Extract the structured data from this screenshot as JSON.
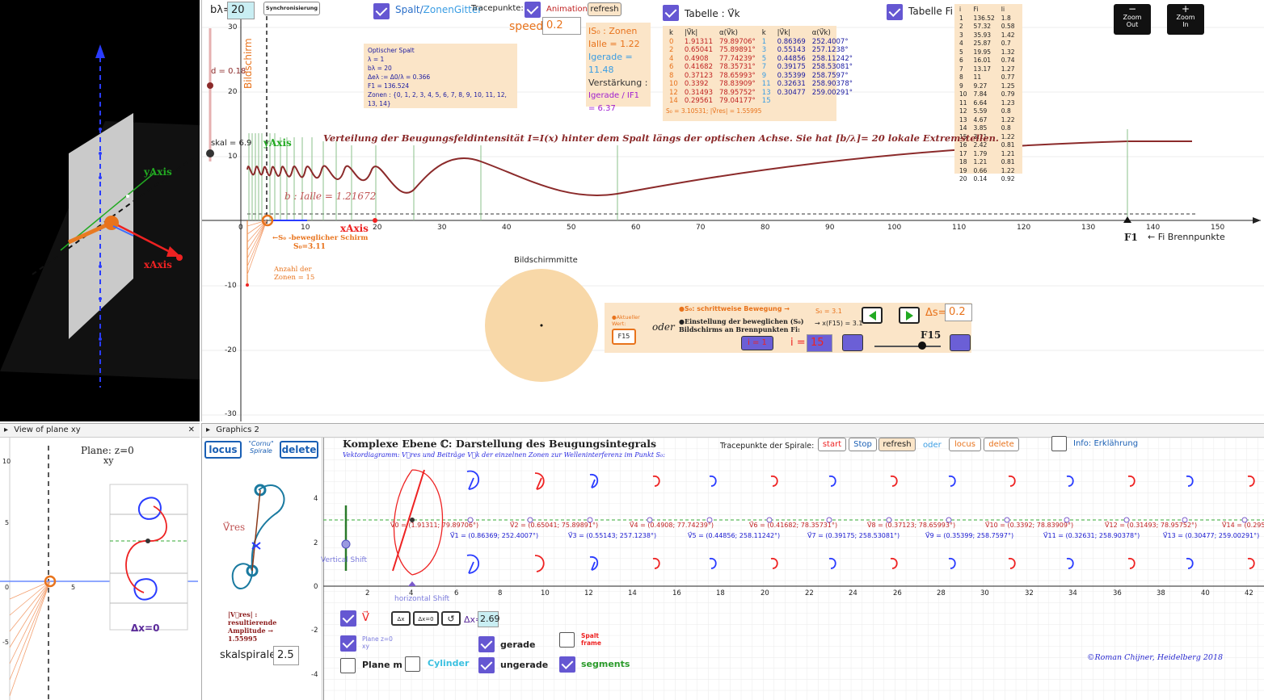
{
  "view3d": {
    "x_label": "xAxis",
    "y_label": "yAxis",
    "slider_d": "d = 0.18",
    "slider_skal": "skal = 6.9"
  },
  "top": {
    "b_lambda_label": "bλ=",
    "b_lambda_value": "20",
    "sync_button": "Synchronisierung",
    "spalt_label_a": "Spalt/",
    "spalt_label_b": "ZonenGitter",
    "tracepunkte": "Tracepunkte:",
    "animation": "Animation",
    "refresh": "refresh",
    "speed_label": "speed=",
    "speed_value": "0.2",
    "tabelle_vk": "Tabelle : V⃗k",
    "tabelle_fi": "Tabelle Fi",
    "zoom_out": "Zoom Out",
    "zoom_in": "Zoom In",
    "minus": "−",
    "plus": "+",
    "bildschirm": "Bildschirm",
    "y_axis_label": "yAxis",
    "x_axis_label": "xAxis",
    "f1_label": "F1",
    "brennpunkte": "← Fi Brennpunkte",
    "curve_title": "Verteilung der Beugungsfeldintensität I=I(x) hinter dem Spalt längs der optischen Achse. Sie hat [b/λ]= 20 lokale Extremstellen.",
    "b_label": "b : Ialle = 1.21672",
    "screen_label": "←S₀ -beweglicher Schirm",
    "screen_value": "S₀=3.11",
    "zones_label": "Anzahl der Zonen = 15",
    "x_ticks": [
      "0",
      "10",
      "20",
      "30",
      "40",
      "50",
      "60",
      "70",
      "80",
      "90",
      "100",
      "110",
      "120",
      "130",
      "140",
      "150"
    ],
    "y_ticks": [
      "30",
      "20",
      "10",
      "-10",
      "-20",
      "-30"
    ],
    "bildschirmmitte": "Bildschirmmitte"
  },
  "optik_box": {
    "lines": [
      "Optischer Spalt",
      "λ = 1",
      "bλ = 20",
      "Δeλ := Δ0/λ = 0.366",
      "F1 = 136.524",
      "Zonen : {0, 1, 2, 3, 4, 5, 6, 7, 8, 9, 10, 11, 12, 13, 14}"
    ]
  },
  "zones_box": {
    "title": "IS₀ : Zonen",
    "ialle": "Ialle = 1.22",
    "igerade": "Igerade = 11.48",
    "verst": "Verstärkung :",
    "ratio": "Igerade / IF1 = 6.37"
  },
  "vk_table": {
    "headers": [
      "k",
      "|V⃗k|",
      "α(V⃗k)",
      "k",
      "|V⃗k|",
      "α(V⃗k)"
    ],
    "rows": [
      [
        "0",
        "1.91311",
        "79.89706°",
        "1",
        "0.86369",
        "252.4007°"
      ],
      [
        "2",
        "0.65041",
        "75.89891°",
        "3",
        "0.55143",
        "257.1238°"
      ],
      [
        "4",
        "0.4908",
        "77.74239°",
        "5",
        "0.44856",
        "258.11242°"
      ],
      [
        "6",
        "0.41682",
        "78.35731°",
        "7",
        "0.39175",
        "258.53081°"
      ],
      [
        "8",
        "0.37123",
        "78.65993°",
        "9",
        "0.35399",
        "258.7597°"
      ],
      [
        "10",
        "0.3392",
        "78.83909°",
        "11",
        "0.32631",
        "258.90378°"
      ],
      [
        "12",
        "0.31493",
        "78.95752°",
        "13",
        "0.30477",
        "259.00291°"
      ],
      [
        "14",
        "0.29561",
        "79.04177°",
        "15",
        "",
        ""
      ]
    ],
    "footer": "S₀ = 3.10531; |V⃗res| = 1.55995"
  },
  "fi_table": {
    "headers": [
      "i",
      "Fi",
      "Ii"
    ],
    "rows": [
      [
        "1",
        "136.52",
        "1.8"
      ],
      [
        "2",
        "57.32",
        "0.58"
      ],
      [
        "3",
        "35.93",
        "1.42"
      ],
      [
        "4",
        "25.87",
        "0.7"
      ],
      [
        "5",
        "19.95",
        "1.32"
      ],
      [
        "6",
        "16.01",
        "0.74"
      ],
      [
        "7",
        "13.17",
        "1.27"
      ],
      [
        "8",
        "11",
        "0.77"
      ],
      [
        "9",
        "9.27",
        "1.25"
      ],
      [
        "10",
        "7.84",
        "0.79"
      ],
      [
        "11",
        "6.64",
        "1.23"
      ],
      [
        "12",
        "5.59",
        "0.8"
      ],
      [
        "13",
        "4.67",
        "1.22"
      ],
      [
        "14",
        "3.85",
        "0.8"
      ],
      [
        "15",
        "3.11",
        "1.22"
      ],
      [
        "16",
        "2.42",
        "0.81"
      ],
      [
        "17",
        "1.79",
        "1.21"
      ],
      [
        "18",
        "1.21",
        "0.81"
      ],
      [
        "19",
        "0.66",
        "1.22"
      ],
      [
        "20",
        "0.14",
        "0.92"
      ]
    ]
  },
  "control_box": {
    "aktueller": "●Aktueller Wert:",
    "f15": "F15",
    "oder": "oder",
    "s0_step": "●S₀: schrittweise Bewegung →",
    "einstellung": "●Einstellung der beweglichen (S₀) Bildschirms an Brennpunkten Fi:",
    "s0_val": "S₀ = 3.1",
    "xf": "→ x(F15) = 3.1",
    "ds_label": "Δs=",
    "ds_value": "0.2",
    "i1": "i = 1",
    "i_label": "i =",
    "i_value": "15",
    "f15_slider": "F15"
  },
  "plane_panel": {
    "title": "View of plane xy",
    "plane": "Plane: z=0",
    "xy": "xy",
    "dx": "Δx=0",
    "ticks_y": [
      "10",
      "5",
      "0",
      "-5"
    ],
    "tick_x": "5"
  },
  "graphics2": {
    "title": "Graphics 2",
    "locus": "locus",
    "cornu": "\"Cornu\" Spirale",
    "delete": "delete",
    "vres": "V⃗res",
    "result": "|V⃗res| : resultierende Amplitude → 1.55995",
    "skal_label": "skalspirale=",
    "skal_value": "2.5"
  },
  "complex": {
    "title": "Komplexe Ebene ℂ: Darstellung des Beugungsintegrals",
    "subtitle": "Vektordiagramm: V⃗res und Beiträge V⃗k der einzelnen Zonen zur Welleninterferenz im Punkt S₀:",
    "trace": "Tracepunkte der Spirale:",
    "start": "start",
    "stop": "Stop",
    "refresh": "refresh",
    "oder": "oder",
    "locus": "locus",
    "delete": "delete",
    "info": "Info: Erklährung",
    "vertical": "Vertical Shift",
    "horizontal": "horizontal Shift",
    "v_label": "V⃗",
    "dx_btn": "Δx",
    "dx0_btn": "Δx=0",
    "rot": "↺",
    "dx_label": "Δx=",
    "dx_value": "2.69",
    "plane_label": "Plane z=0 xy",
    "plane_m": "Plane m",
    "cylinder": "Cylinder",
    "gerade": "gerade",
    "ungerade": "ungerade",
    "spalt": "Spalt frame",
    "segments": "segments",
    "credit": "©Roman Chijner, Heidelberg 2018",
    "x_ticks": [
      "2",
      "4",
      "6",
      "8",
      "10",
      "12",
      "14",
      "16",
      "18",
      "20",
      "22",
      "24",
      "26",
      "28",
      "30",
      "32",
      "34",
      "36",
      "38",
      "40",
      "42"
    ],
    "y_ticks": [
      "4",
      "2",
      "0",
      "-2",
      "-4"
    ],
    "red_labels": [
      "V⃗0 = (1.91311; 79.89706°)",
      "V⃗2 = (0.65041; 75.89891°)",
      "V⃗4 = (0.4908; 77.74239°)",
      "V⃗6 = (0.41682; 78.35731°)",
      "V⃗8 = (0.37123; 78.65993°)",
      "V⃗10 = (0.3392; 78.83909°)",
      "V⃗12 = (0.31493; 78.95752°)",
      "V⃗14 = (0.29561"
    ],
    "blue_labels": [
      "V⃗1 = (0.86369; 252.4007°)",
      "V⃗3 = (0.55143; 257.1238°)",
      "V⃗5 = (0.44856; 258.11242°)",
      "V⃗7 = (0.39175; 258.53081°)",
      "V⃗9 = (0.35399; 258.7597°)",
      "V⃗11 = (0.32631; 258.90378°)",
      "V⃗13 = (0.30477; 259.00291°)"
    ]
  }
}
